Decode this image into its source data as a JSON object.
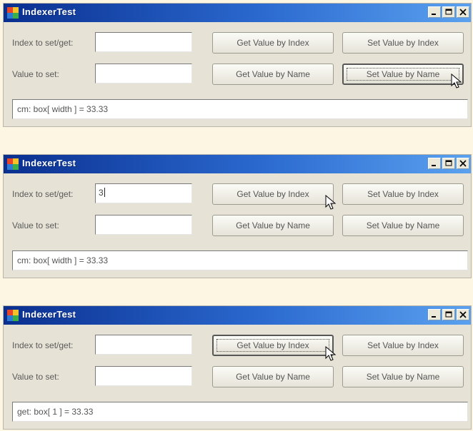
{
  "colors": {
    "titlebar_start": "#0a2f8f",
    "titlebar_end": "#5aa1ef",
    "window_bg": "#e6e2d6",
    "page_bg": "#fdf6e3"
  },
  "icons": {
    "app": "app-icon",
    "minimize": "minimize-icon",
    "maximize": "maximize-icon",
    "close": "close-icon",
    "cursor": "mouse-pointer-icon"
  },
  "windows": [
    {
      "title": "IndexerTest",
      "index_label": "Index to set/get:",
      "index_value": "",
      "value_label": "Value to set:",
      "value_value": "",
      "buttons": {
        "get_by_index": "Get Value by Index",
        "set_by_index": "Set Value by Index",
        "get_by_name": "Get Value by Name",
        "set_by_name": "Set Value by Name"
      },
      "output": "cm: box[ width ] = 33.33",
      "active_button": "set_by_name"
    },
    {
      "title": "IndexerTest",
      "index_label": "Index to set/get:",
      "index_value": "3",
      "value_label": "Value to set:",
      "value_value": "",
      "buttons": {
        "get_by_index": "Get Value by Index",
        "set_by_index": "Set Value by Index",
        "get_by_name": "Get Value by Name",
        "set_by_name": "Set Value by Name"
      },
      "output": "cm: box[ width ] = 33.33",
      "active_button": "none"
    },
    {
      "title": "IndexerTest",
      "index_label": "Index to set/get:",
      "index_value": "",
      "value_label": "Value to set:",
      "value_value": "",
      "buttons": {
        "get_by_index": "Get Value by Index",
        "set_by_index": "Set Value by Index",
        "get_by_name": "Get Value by Name",
        "set_by_name": "Set Value by Name"
      },
      "output": "get: box[ 1 ] = 33.33",
      "active_button": "get_by_index"
    }
  ]
}
